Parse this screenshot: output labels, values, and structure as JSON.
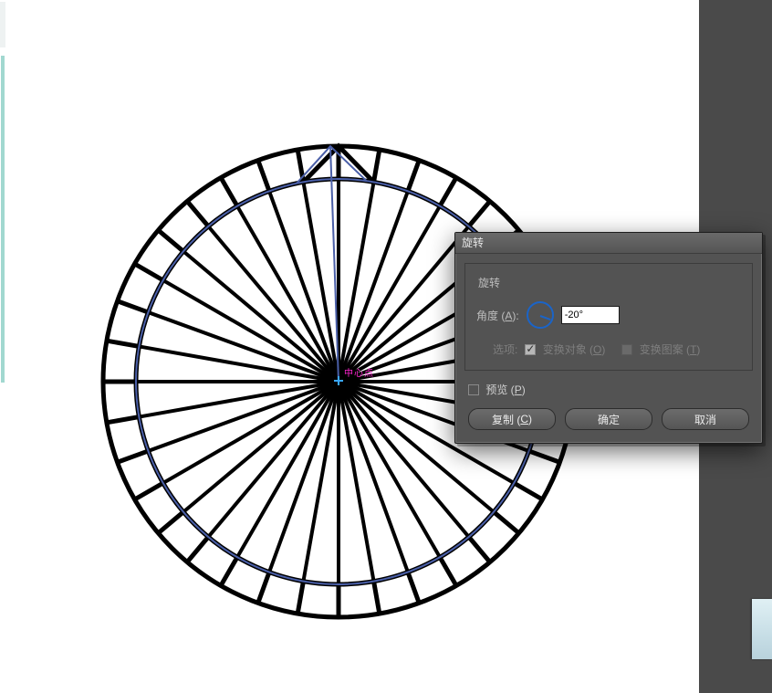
{
  "dialog": {
    "title": "旋转",
    "section_title": "旋转",
    "angle": {
      "label_prefix": "角度 (",
      "label_hotkey": "A",
      "label_suffix": "):",
      "value": "-20°"
    },
    "options": {
      "label": "选项:",
      "transform_objects": {
        "label_prefix": "变换对象 (",
        "label_hotkey": "O",
        "label_suffix": ")",
        "checked": true
      },
      "transform_patterns": {
        "label_prefix": "变换图案 (",
        "label_hotkey": "T",
        "label_suffix": ")",
        "checked": false
      }
    },
    "preview": {
      "label_prefix": "预览 (",
      "label_hotkey": "P",
      "label_suffix": ")",
      "checked": false
    },
    "buttons": {
      "copy": {
        "label_prefix": "复制 (",
        "label_hotkey": "C",
        "label_suffix": ")"
      },
      "ok": {
        "label": "确定"
      },
      "cancel": {
        "label": "取消"
      }
    }
  },
  "canvas": {
    "center_label": "中心点"
  }
}
